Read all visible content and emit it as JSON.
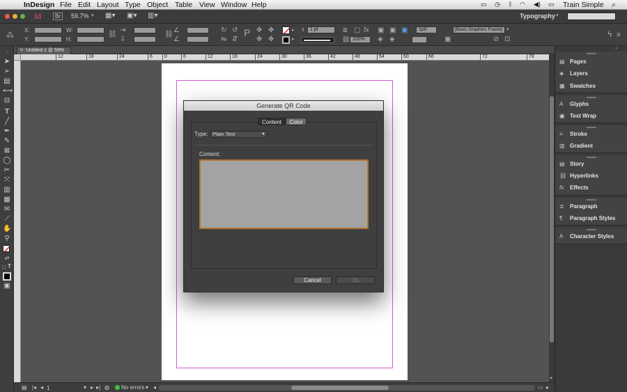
{
  "menubar": {
    "app_name": "InDesign",
    "items": [
      "File",
      "Edit",
      "Layout",
      "Type",
      "Object",
      "Table",
      "View",
      "Window",
      "Help"
    ],
    "user": "Train Simple"
  },
  "appbar": {
    "logo": "Id",
    "bridge": "Br",
    "zoom": "59.7%",
    "workspace": "Typography"
  },
  "controlbar": {
    "x_label": "X:",
    "y_label": "Y:",
    "w_label": "W:",
    "h_label": "H:",
    "stroke_weight": "1 pt",
    "opacity": "100%",
    "spacing": "1p0",
    "object_style": "[Basic Graphics Frame]"
  },
  "document": {
    "tab_title": "Untitled-1 @ 59%",
    "ruler_labels": [
      "12",
      "18",
      "24",
      "6",
      "0",
      "6",
      "12",
      "18",
      "24",
      "30",
      "36",
      "42",
      "48",
      "54",
      "60",
      "66",
      "72",
      "78"
    ]
  },
  "dialog": {
    "title": "Generate QR Code",
    "tabs": [
      "Content",
      "Color"
    ],
    "type_label": "Type:",
    "type_value": "Plain Text",
    "content_label": "Content:",
    "content_value": "",
    "cancel_label": "Cancel",
    "ok_label": "OK"
  },
  "panels": {
    "groups": [
      [
        "Pages",
        "Layers",
        "Swatches"
      ],
      [
        "Glyphs",
        "Text Wrap"
      ],
      [
        "Stroke",
        "Gradient"
      ],
      [
        "Story",
        "Hyperlinks",
        "Effects"
      ],
      [
        "Paragraph",
        "Paragraph Styles"
      ],
      [
        "Character Styles"
      ]
    ]
  },
  "statusbar": {
    "page": "1",
    "errors": "No errors"
  },
  "colors": {
    "margin": "#d25bd2",
    "preflight_ok": "#3fbf3f",
    "indesign": "#e04c8a",
    "content_border": "#b3742e"
  },
  "icons": [
    "apple-icon",
    "wifi-icon",
    "battery-icon",
    "search-icon",
    "selection-tool-icon",
    "type-tool-icon",
    "hand-tool-icon",
    "zoom-tool-icon",
    "pages-icon",
    "layers-icon",
    "swatches-icon",
    "glyphs-icon",
    "text-wrap-icon",
    "stroke-icon",
    "gradient-icon",
    "story-icon",
    "hyperlinks-icon",
    "effects-icon",
    "paragraph-icon",
    "paragraph-styles-icon",
    "character-styles-icon"
  ]
}
